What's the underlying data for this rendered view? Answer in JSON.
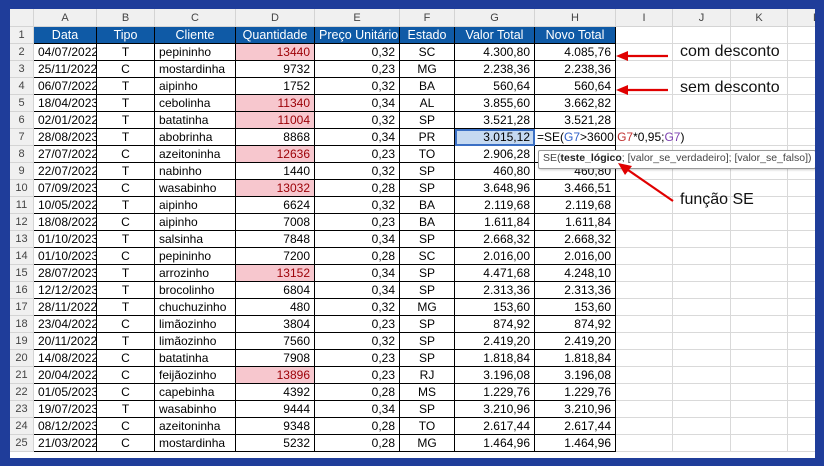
{
  "columns": [
    "A",
    "B",
    "C",
    "D",
    "E",
    "F",
    "G",
    "H",
    "I",
    "J",
    "K",
    "L"
  ],
  "headers": [
    "Data",
    "Tipo",
    "Cliente",
    "Quantidade",
    "Preço Unitário",
    "Estado",
    "Valor Total",
    "Novo Total"
  ],
  "rows": [
    {
      "n": "1"
    },
    {
      "n": "2",
      "data": "04/07/2022",
      "tipo": "T",
      "cliente": "pepininho",
      "qtd": "13440",
      "preco": "0,32",
      "estado": "SC",
      "total": "4.300,80",
      "novo": "4.085,76",
      "highlight": true
    },
    {
      "n": "3",
      "data": "25/11/2022",
      "tipo": "C",
      "cliente": "mostardinha",
      "qtd": "9732",
      "preco": "0,23",
      "estado": "MG",
      "total": "2.238,36",
      "novo": "2.238,36",
      "highlight": false
    },
    {
      "n": "4",
      "data": "06/07/2022",
      "tipo": "T",
      "cliente": "aipinho",
      "qtd": "1752",
      "preco": "0,32",
      "estado": "BA",
      "total": "560,64",
      "novo": "560,64",
      "highlight": false
    },
    {
      "n": "5",
      "data": "18/04/2023",
      "tipo": "T",
      "cliente": "cebolinha",
      "qtd": "11340",
      "preco": "0,34",
      "estado": "AL",
      "total": "3.855,60",
      "novo": "3.662,82",
      "highlight": true
    },
    {
      "n": "6",
      "data": "02/01/2022",
      "tipo": "T",
      "cliente": "batatinha",
      "qtd": "11004",
      "preco": "0,32",
      "estado": "SP",
      "total": "3.521,28",
      "novo": "3.521,28",
      "highlight": true
    },
    {
      "n": "7",
      "data": "28/08/2023",
      "tipo": "T",
      "cliente": "abobrinha",
      "qtd": "8868",
      "preco": "0,34",
      "estado": "PR",
      "total": "3.015,12",
      "novo": "",
      "highlight": false
    },
    {
      "n": "8",
      "data": "27/07/2022",
      "tipo": "C",
      "cliente": "azeitoninha",
      "qtd": "12636",
      "preco": "0,23",
      "estado": "TO",
      "total": "2.906,28",
      "novo": "",
      "highlight": true
    },
    {
      "n": "9",
      "data": "22/07/2022",
      "tipo": "T",
      "cliente": "nabinho",
      "qtd": "1440",
      "preco": "0,32",
      "estado": "SP",
      "total": "460,80",
      "novo": "460,80",
      "highlight": false
    },
    {
      "n": "10",
      "data": "07/09/2023",
      "tipo": "C",
      "cliente": "wasabinho",
      "qtd": "13032",
      "preco": "0,28",
      "estado": "SP",
      "total": "3.648,96",
      "novo": "3.466,51",
      "highlight": true
    },
    {
      "n": "11",
      "data": "10/05/2022",
      "tipo": "T",
      "cliente": "aipinho",
      "qtd": "6624",
      "preco": "0,32",
      "estado": "BA",
      "total": "2.119,68",
      "novo": "2.119,68",
      "highlight": false
    },
    {
      "n": "12",
      "data": "18/08/2022",
      "tipo": "C",
      "cliente": "aipinho",
      "qtd": "7008",
      "preco": "0,23",
      "estado": "BA",
      "total": "1.611,84",
      "novo": "1.611,84",
      "highlight": false
    },
    {
      "n": "13",
      "data": "01/10/2023",
      "tipo": "T",
      "cliente": "salsinha",
      "qtd": "7848",
      "preco": "0,34",
      "estado": "SP",
      "total": "2.668,32",
      "novo": "2.668,32",
      "highlight": false
    },
    {
      "n": "14",
      "data": "01/10/2023",
      "tipo": "C",
      "cliente": "pepininho",
      "qtd": "7200",
      "preco": "0,28",
      "estado": "SC",
      "total": "2.016,00",
      "novo": "2.016,00",
      "highlight": false
    },
    {
      "n": "15",
      "data": "28/07/2023",
      "tipo": "T",
      "cliente": "arrozinho",
      "qtd": "13152",
      "preco": "0,34",
      "estado": "SP",
      "total": "4.471,68",
      "novo": "4.248,10",
      "highlight": true
    },
    {
      "n": "16",
      "data": "12/12/2023",
      "tipo": "T",
      "cliente": "brocolinho",
      "qtd": "6804",
      "preco": "0,34",
      "estado": "SP",
      "total": "2.313,36",
      "novo": "2.313,36",
      "highlight": false
    },
    {
      "n": "17",
      "data": "28/11/2022",
      "tipo": "T",
      "cliente": "chuchuzinho",
      "qtd": "480",
      "preco": "0,32",
      "estado": "MG",
      "total": "153,60",
      "novo": "153,60",
      "highlight": false
    },
    {
      "n": "18",
      "data": "23/04/2022",
      "tipo": "C",
      "cliente": "limãozinho",
      "qtd": "3804",
      "preco": "0,23",
      "estado": "SP",
      "total": "874,92",
      "novo": "874,92",
      "highlight": false
    },
    {
      "n": "19",
      "data": "20/11/2022",
      "tipo": "T",
      "cliente": "limãozinho",
      "qtd": "7560",
      "preco": "0,32",
      "estado": "SP",
      "total": "2.419,20",
      "novo": "2.419,20",
      "highlight": false
    },
    {
      "n": "20",
      "data": "14/08/2022",
      "tipo": "C",
      "cliente": "batatinha",
      "qtd": "7908",
      "preco": "0,23",
      "estado": "SP",
      "total": "1.818,84",
      "novo": "1.818,84",
      "highlight": false
    },
    {
      "n": "21",
      "data": "20/04/2022",
      "tipo": "C",
      "cliente": "feijãozinho",
      "qtd": "13896",
      "preco": "0,23",
      "estado": "RJ",
      "total": "3.196,08",
      "novo": "3.196,08",
      "highlight": true
    },
    {
      "n": "22",
      "data": "01/05/2023",
      "tipo": "C",
      "cliente": "capebinha",
      "qtd": "4392",
      "preco": "0,28",
      "estado": "MS",
      "total": "1.229,76",
      "novo": "1.229,76",
      "highlight": false
    },
    {
      "n": "23",
      "data": "19/07/2023",
      "tipo": "T",
      "cliente": "wasabinho",
      "qtd": "9444",
      "preco": "0,34",
      "estado": "SP",
      "total": "3.210,96",
      "novo": "3.210,96",
      "highlight": false
    },
    {
      "n": "24",
      "data": "08/12/2023",
      "tipo": "C",
      "cliente": "azeitoninha",
      "qtd": "9348",
      "preco": "0,28",
      "estado": "TO",
      "total": "2.617,44",
      "novo": "2.617,44",
      "highlight": false
    },
    {
      "n": "25",
      "data": "21/03/2022",
      "tipo": "C",
      "cliente": "mostardinha",
      "qtd": "5232",
      "preco": "0,28",
      "estado": "MG",
      "total": "1.464,96",
      "novo": "1.464,96",
      "highlight": false
    }
  ],
  "formula": {
    "prefix": "=SE(",
    "ref1": "G7",
    "op1": ">",
    "num": "3600",
    "sep1": ";",
    "ref2": "G7",
    "mult": "*0,95;",
    "ref3": "G7",
    "close": ")"
  },
  "tooltip": {
    "fn": "SE(",
    "arg1": "teste_lógico",
    "rest": "; [valor_se_verdadeiro]; [valor_se_falso])"
  },
  "annotations": {
    "com_desconto": "com desconto",
    "sem_desconto": "sem desconto",
    "funcao_se": "função SE"
  },
  "colors": {
    "header_bg": "#0f5aa6",
    "highlight_bg": "#f7c7ce",
    "highlight_text": "#9c0006",
    "arrow": "#e00000",
    "frame": "#1f3d9a"
  }
}
